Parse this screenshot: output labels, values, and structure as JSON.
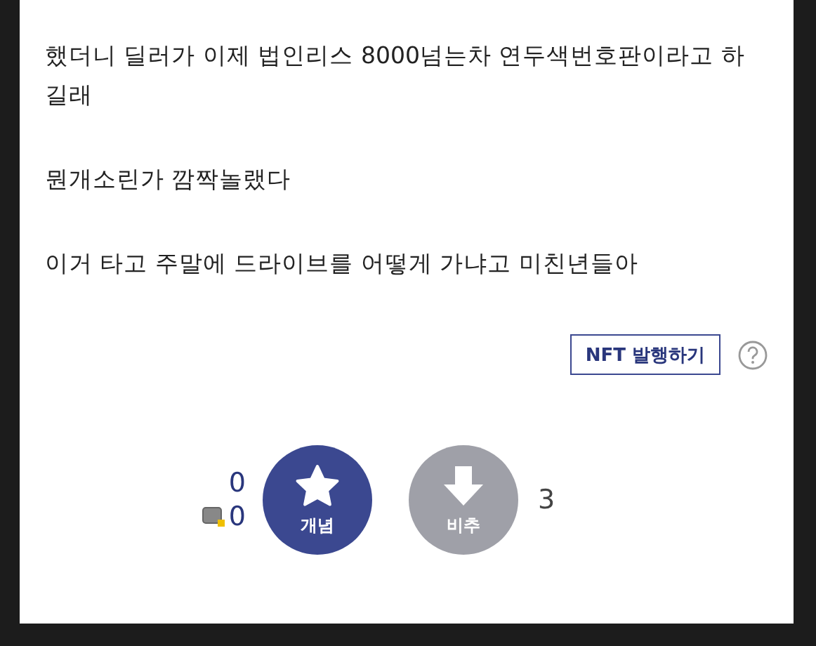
{
  "post": {
    "paragraphs": [
      "했더니 딜러가 이제 법인리스 8000넘는차 연두색번호판이라고 하길래",
      "뭔개소린가 깜짝놀랬다",
      "이거 타고 주말에 드라이브를 어떻게 가냐고 미친년들아"
    ]
  },
  "nft_button": {
    "label": "NFT 발행하기"
  },
  "votes": {
    "up_count": "0",
    "fixed_count": "0",
    "up_label": "개념",
    "down_label": "비추",
    "down_count": "3"
  }
}
